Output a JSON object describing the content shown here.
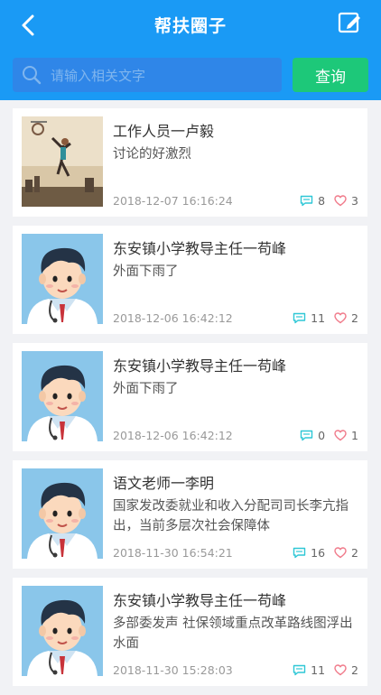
{
  "header": {
    "title": "帮扶圈子"
  },
  "search": {
    "placeholder": "请输入相关文字",
    "button_label": "查询"
  },
  "posts": [
    {
      "author": "工作人员一卢毅",
      "content": "讨论的好激烈",
      "time": "2018-12-07 16:16:24",
      "comments": "8",
      "likes": "3",
      "avatar": "photo-basketball"
    },
    {
      "author": "东安镇小学教导主任一苟峰",
      "content": "外面下雨了",
      "time": "2018-12-06 16:42:12",
      "comments": "11",
      "likes": "2",
      "avatar": "doctor-cartoon"
    },
    {
      "author": "东安镇小学教导主任一苟峰",
      "content": "外面下雨了",
      "time": "2018-12-06 16:42:12",
      "comments": "0",
      "likes": "1",
      "avatar": "doctor-cartoon"
    },
    {
      "author": "语文老师一李明",
      "content": "国家发改委就业和收入分配司司长李亢指出，当前多层次社会保障体",
      "time": "2018-11-30 16:54:21",
      "comments": "16",
      "likes": "2",
      "avatar": "doctor-cartoon"
    },
    {
      "author": "东安镇小学教导主任一苟峰",
      "content": "多部委发声 社保领域重点改革路线图浮出水面",
      "time": "2018-11-30 15:28:03",
      "comments": "11",
      "likes": "2",
      "avatar": "doctor-cartoon"
    }
  ],
  "colors": {
    "header": "#1a9af5",
    "search_bg": "#2f86e8",
    "query_button": "#1dc879",
    "comment_icon": "#2ec7d6",
    "like_icon": "#f07a8a"
  }
}
